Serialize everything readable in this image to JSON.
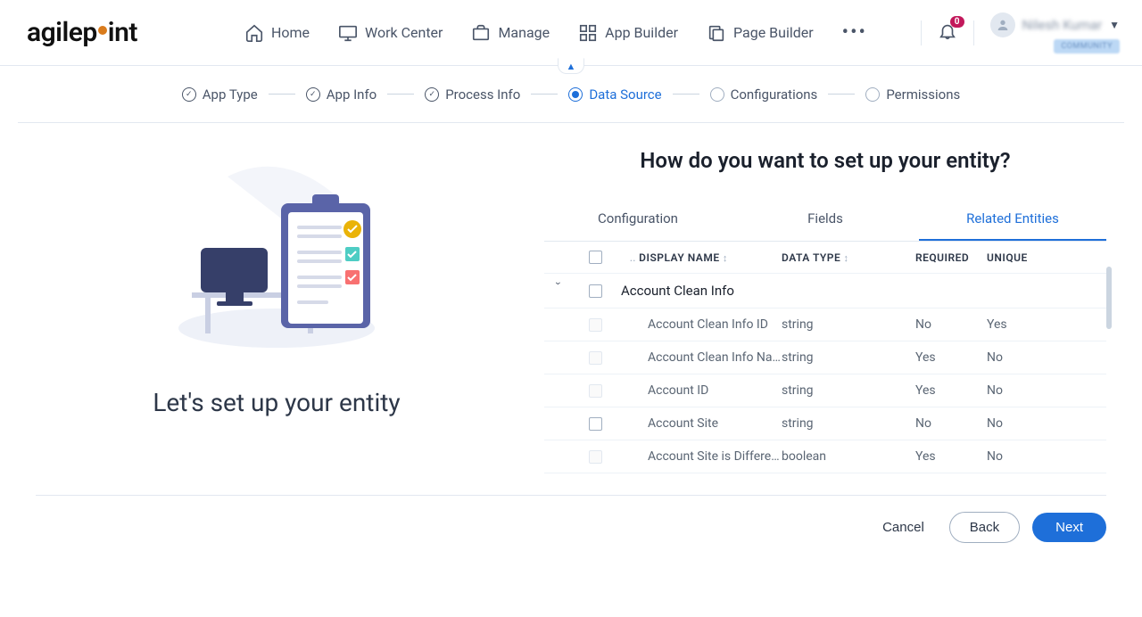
{
  "brand": {
    "pre": "agilep",
    "post": "int"
  },
  "nav": {
    "items": [
      {
        "label": "Home",
        "icon": "home"
      },
      {
        "label": "Work Center",
        "icon": "monitor"
      },
      {
        "label": "Manage",
        "icon": "briefcase"
      },
      {
        "label": "App Builder",
        "icon": "grid"
      },
      {
        "label": "Page Builder",
        "icon": "copy"
      }
    ],
    "notification_count": "0",
    "user_name": "Nilesh Kumar",
    "user_tag": "COMMUNITY"
  },
  "wizard": {
    "steps": [
      {
        "label": "App Type",
        "state": "done"
      },
      {
        "label": "App Info",
        "state": "done"
      },
      {
        "label": "Process Info",
        "state": "done"
      },
      {
        "label": "Data Source",
        "state": "active"
      },
      {
        "label": "Configurations",
        "state": "pending"
      },
      {
        "label": "Permissions",
        "state": "pending"
      }
    ]
  },
  "left": {
    "title": "Let's set up your entity"
  },
  "right": {
    "title": "How do you want to set up your entity?",
    "tabs": [
      {
        "label": "Configuration",
        "active": false
      },
      {
        "label": "Fields",
        "active": false
      },
      {
        "label": "Related Entities",
        "active": true
      }
    ],
    "columns": {
      "display_name": "DISPLAY NAME",
      "data_type": "DATA TYPE",
      "required": "REQUIRED",
      "unique": "UNIQUE"
    },
    "group": {
      "label": "Account Clean Info"
    },
    "rows": [
      {
        "name": "Account Clean Info ID",
        "type": "string",
        "required": "No",
        "unique": "Yes",
        "selectable": false
      },
      {
        "name": "Account Clean Info Na…",
        "type": "string",
        "required": "Yes",
        "unique": "No",
        "selectable": false
      },
      {
        "name": "Account ID",
        "type": "string",
        "required": "Yes",
        "unique": "No",
        "selectable": false
      },
      {
        "name": "Account Site",
        "type": "string",
        "required": "No",
        "unique": "No",
        "selectable": true
      },
      {
        "name": "Account Site is Differe…",
        "type": "boolean",
        "required": "Yes",
        "unique": "No",
        "selectable": false
      }
    ]
  },
  "footer": {
    "cancel": "Cancel",
    "back": "Back",
    "next": "Next"
  }
}
